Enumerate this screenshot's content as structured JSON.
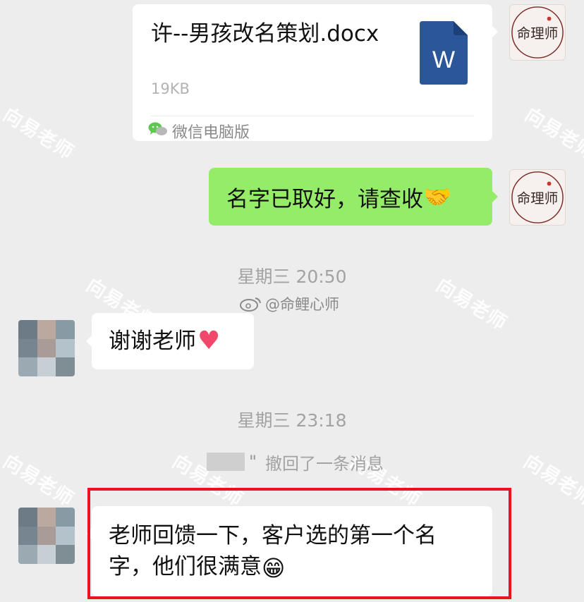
{
  "file_message": {
    "file_name": "许--男孩改名策划.docx",
    "file_size": "19KB",
    "file_icon": "word-doc-icon",
    "word_letter": "W",
    "source_label": "微信电脑版",
    "source_icon": "wechat-icon"
  },
  "reply_message": {
    "text": "名字已取好，请查收",
    "emoji": "🤝",
    "emoji_icon": "handshake-icon"
  },
  "timestamps": [
    "星期三 20:50",
    "星期三 23:18"
  ],
  "weibo_tag": "@命鲤心师",
  "thanks_message": {
    "text": "谢谢老师",
    "emoji": "♥",
    "emoji_icon": "heart-icon"
  },
  "recall_notice": {
    "mark": "\"",
    "text": "撤回了一条消息"
  },
  "feedback_message": {
    "text": "老师回馈一下，客户选的第一个名字，他们很满意",
    "emoji": "😁",
    "emoji_icon": "grin-icon"
  },
  "watermark_text": "向易老师",
  "teacher_avatar": {
    "name": "命理师"
  },
  "colors": {
    "background": "#ededed",
    "green_bubble": "#95ec69",
    "highlight": "#e8141b",
    "word_blue": "#2b579a"
  }
}
